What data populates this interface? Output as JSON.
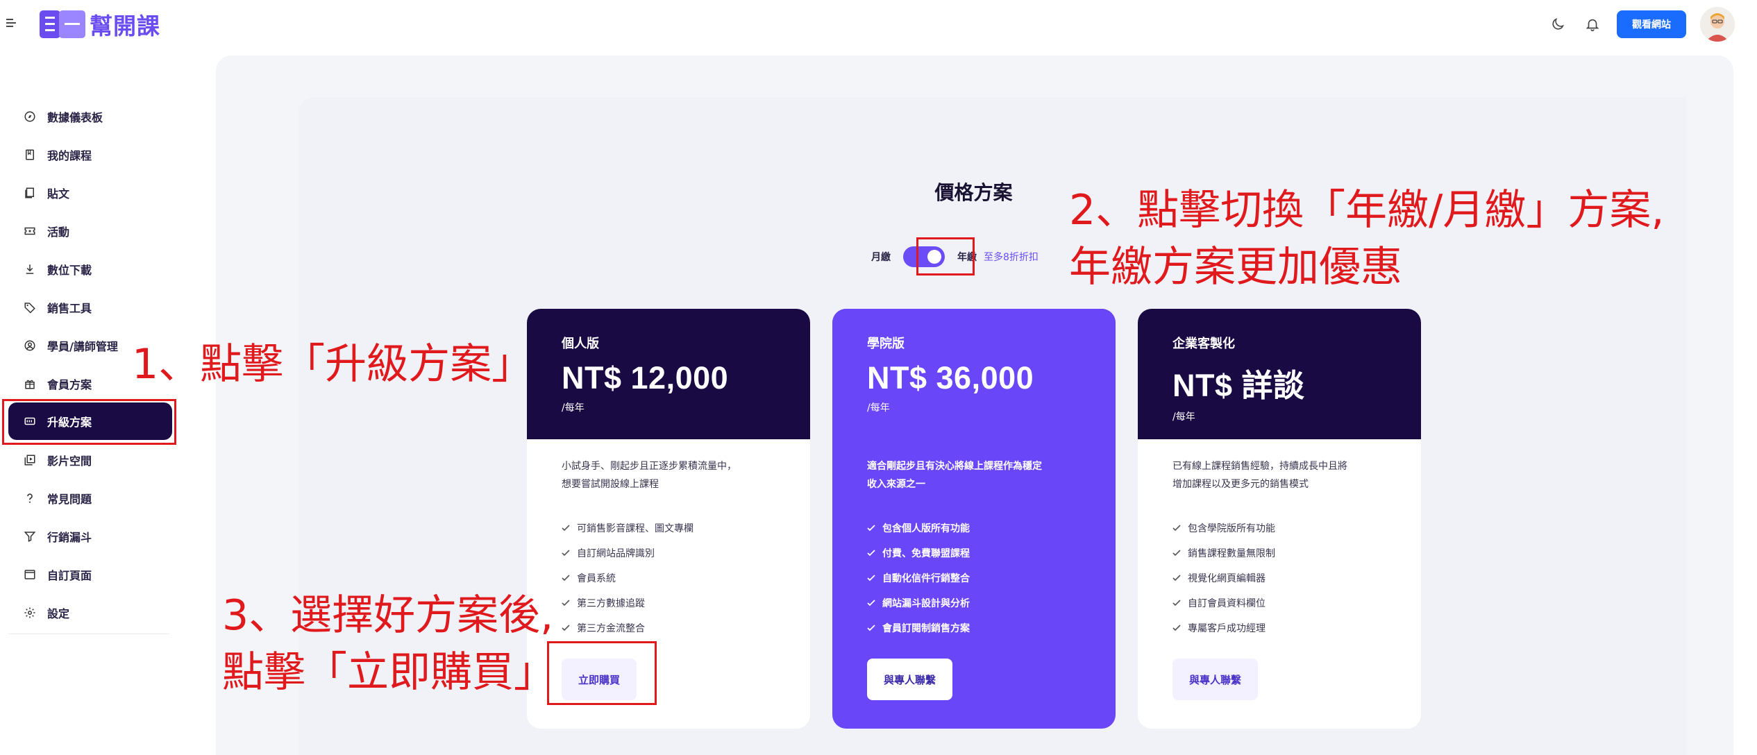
{
  "topbar": {
    "logo_text": "幫開課",
    "view_site_label": "觀看網站"
  },
  "sidebar": {
    "items": [
      {
        "label": "數據儀表板",
        "icon": "compass-icon"
      },
      {
        "label": "我的課程",
        "icon": "book-icon"
      },
      {
        "label": "貼文",
        "icon": "post-icon"
      },
      {
        "label": "活動",
        "icon": "ticket-icon"
      },
      {
        "label": "數位下載",
        "icon": "download-icon"
      },
      {
        "label": "銷售工具",
        "icon": "tag-icon"
      },
      {
        "label": "學員/講師管理",
        "icon": "user-circle-icon"
      },
      {
        "label": "會員方案",
        "icon": "gift-icon"
      },
      {
        "label": "升級方案",
        "icon": "upgrade-icon",
        "active": true
      },
      {
        "label": "影片空間",
        "icon": "video-library-icon"
      },
      {
        "label": "常見問題",
        "icon": "question-icon"
      },
      {
        "label": "行銷漏斗",
        "icon": "funnel-icon"
      },
      {
        "label": "自訂頁面",
        "icon": "page-icon"
      },
      {
        "label": "設定",
        "icon": "gear-icon"
      }
    ]
  },
  "main": {
    "title": "價格方案",
    "billing": {
      "monthly_label": "月繳",
      "yearly_label": "年繳",
      "discount_text": "至多8折折扣",
      "selected": "yearly"
    },
    "plans": [
      {
        "name": "個人版",
        "price": "NT$ 12,000",
        "period": "/每年",
        "desc_line1": "小試身手、剛起步且正逐步累積流量中，",
        "desc_line2": "想要嘗試開設線上課程",
        "features": [
          "可銷售影音課程、圖文專欄",
          "自訂網站品牌識別",
          "會員系統",
          "第三方數據追蹤",
          "第三方金流整合"
        ],
        "cta": "立即購買"
      },
      {
        "name": "學院版",
        "price": "NT$ 36,000",
        "period": "/每年",
        "desc_line1": "適合剛起步且有決心將線上課程作為穩定",
        "desc_line2": "收入來源之一",
        "features": [
          "包含個人版所有功能",
          "付費、免費聯盟課程",
          "自動化信件行銷整合",
          "網站漏斗設計與分析",
          "會員訂閱制銷售方案"
        ],
        "cta": "與專人聯繫"
      },
      {
        "name": "企業客製化",
        "price": "NT$ 詳談",
        "period": "/每年",
        "desc_line1": "已有線上課程銷售經驗，持續成長中且將",
        "desc_line2": "增加課程以及更多元的銷售模式",
        "features": [
          "包含學院版所有功能",
          "銷售課程數量無限制",
          "視覺化網頁編輯器",
          "自訂會員資料欄位",
          "專屬客戶成功經理"
        ],
        "cta": "與專人聯繫"
      }
    ]
  },
  "annotations": {
    "step1": "1、點擊「升級方案」",
    "step2_line1": "2、點擊切換「年繳/月繳」方案,",
    "step2_line2": "年繳方案更加優惠",
    "step3_line1": "3、選擇好方案後,",
    "step3_line2": "點擊「立即購買」"
  },
  "colors": {
    "annotation_red": "#e0191d",
    "brand_purple": "#6946f7",
    "dark_navy": "#1a0a44",
    "primary_blue": "#1a6cff"
  }
}
